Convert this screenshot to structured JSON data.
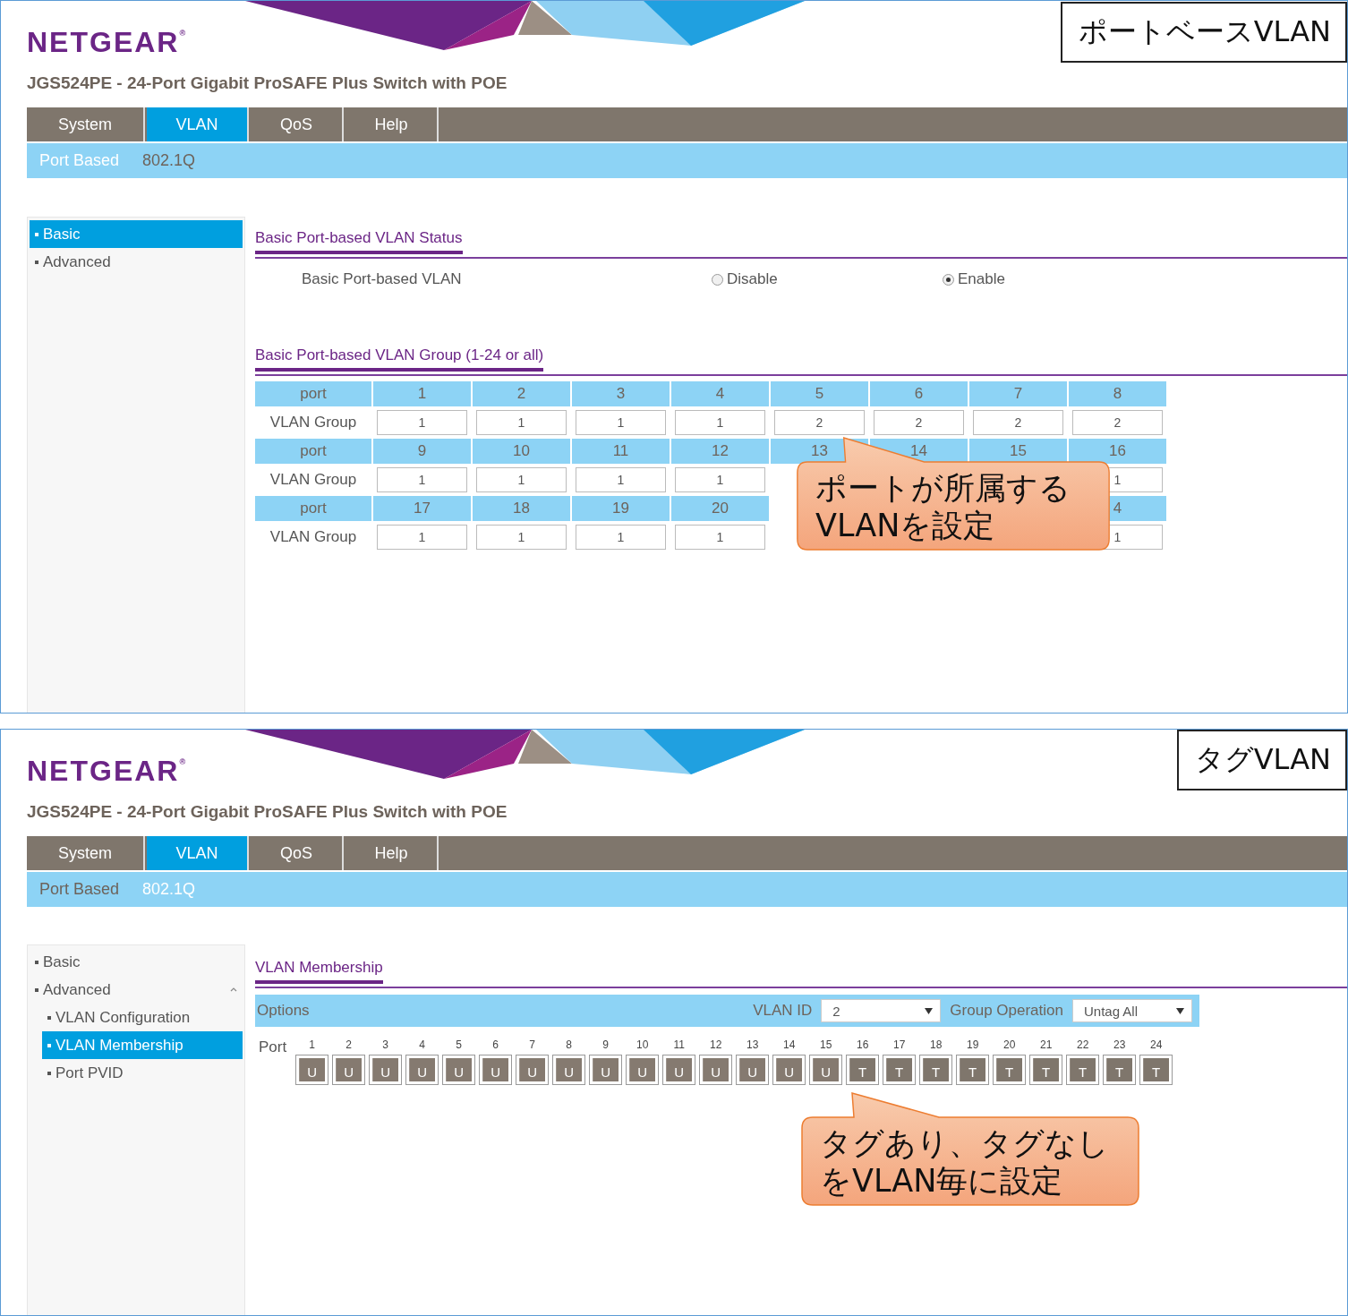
{
  "panels": [
    {
      "kind": "port_based",
      "label": "ポートベースVLAN",
      "logo": "NETGEAR$^{®}$",
      "title": "JGS524PE - 24-Port Gigabit ProSAFE Plus Switch with POE",
      "tabs": [
        {
          "label": "System",
          "selected": false
        },
        {
          "label": "VLAN",
          "selected": true
        },
        {
          "label": "QoS",
          "selected": false
        },
        {
          "label": "Help",
          "selected": false
        }
      ],
      "subtabs": [
        {
          "label": "Port Based",
          "selected": true
        },
        {
          "label": "802.1Q",
          "selected": false
        }
      ],
      "sidebar": [
        {
          "label": "Basic",
          "selected": true
        },
        {
          "label": "Advanced",
          "selected": false
        }
      ],
      "status": {
        "heading": "Basic Port-based VLAN Status",
        "label": "Basic Port-based VLAN",
        "options": [
          {
            "label": "Disable",
            "selected": false
          },
          {
            "label": "Enable",
            "selected": true
          }
        ]
      },
      "group": {
        "heading": "Basic Port-based VLAN Group (1-24 or all)",
        "rows": [
          {
            "kind": "header",
            "label": "port",
            "cells": [
              "1",
              "2",
              "3",
              "4",
              "5",
              "6",
              "7",
              "8"
            ]
          },
          {
            "kind": "input",
            "label": "VLAN Group",
            "cells": [
              "1",
              "1",
              "1",
              "1",
              "2",
              "2",
              "2",
              "2"
            ]
          },
          {
            "kind": "header",
            "label": "port",
            "cells": [
              "9",
              "10",
              "11",
              "12",
              "13",
              "14",
              "15",
              "16"
            ]
          },
          {
            "kind": "input",
            "label": "VLAN Group",
            "cells": [
              "1",
              "1",
              "1",
              "1",
              null,
              null,
              null,
              "1"
            ]
          },
          {
            "kind": "header",
            "label": "port",
            "cells": [
              "17",
              "18",
              "19",
              "20",
              null,
              null,
              null,
              "4"
            ]
          },
          {
            "kind": "input",
            "label": "VLAN Group",
            "cells": [
              "1",
              "1",
              "1",
              "1",
              null,
              null,
              null,
              "1"
            ]
          }
        ]
      },
      "callout": [
        "ポートが所属する",
        "VLANを設定"
      ]
    },
    {
      "kind": "tagged",
      "label": "タグVLAN",
      "logo": "NETGEAR$^{®}$",
      "title": "JGS524PE - 24-Port Gigabit ProSAFE Plus Switch with POE",
      "tabs": [
        {
          "label": "System",
          "selected": false
        },
        {
          "label": "VLAN",
          "selected": true
        },
        {
          "label": "QoS",
          "selected": false
        },
        {
          "label": "Help",
          "selected": false
        }
      ],
      "subtabs": [
        {
          "label": "Port Based",
          "selected": false
        },
        {
          "label": "802.1Q",
          "selected": true
        }
      ],
      "sidebar": [
        {
          "label": "Basic",
          "selected": false
        },
        {
          "label": "Advanced",
          "selected": false,
          "expanded": true,
          "children": [
            {
              "label": "VLAN Configuration",
              "selected": false
            },
            {
              "label": "VLAN Membership",
              "selected": true
            },
            {
              "label": "Port PVID",
              "selected": false
            }
          ]
        }
      ],
      "membership": {
        "heading": "VLAN Membership",
        "options_label": "Options",
        "vlan_id": {
          "label": "VLAN ID",
          "value": "2"
        },
        "group_operation": {
          "label": "Group Operation",
          "value": "Untag All"
        },
        "port_label": "Port",
        "ports": [
          {
            "number": "1",
            "mode": "U"
          },
          {
            "number": "2",
            "mode": "U"
          },
          {
            "number": "3",
            "mode": "U"
          },
          {
            "number": "4",
            "mode": "U"
          },
          {
            "number": "5",
            "mode": "U"
          },
          {
            "number": "6",
            "mode": "U"
          },
          {
            "number": "7",
            "mode": "U"
          },
          {
            "number": "8",
            "mode": "U"
          },
          {
            "number": "9",
            "mode": "U"
          },
          {
            "number": "10",
            "mode": "U"
          },
          {
            "number": "11",
            "mode": "U"
          },
          {
            "number": "12",
            "mode": "U"
          },
          {
            "number": "13",
            "mode": "U"
          },
          {
            "number": "14",
            "mode": "U"
          },
          {
            "number": "15",
            "mode": "U"
          },
          {
            "number": "16",
            "mode": "T"
          },
          {
            "number": "17",
            "mode": "T"
          },
          {
            "number": "18",
            "mode": "T"
          },
          {
            "number": "19",
            "mode": "T"
          },
          {
            "number": "20",
            "mode": "T"
          },
          {
            "number": "21",
            "mode": "T"
          },
          {
            "number": "22",
            "mode": "T"
          },
          {
            "number": "23",
            "mode": "T"
          },
          {
            "number": "24",
            "mode": "T"
          }
        ]
      },
      "callout": [
        "タグあり、タグなし",
        "をVLAN毎に設定"
      ]
    }
  ]
}
